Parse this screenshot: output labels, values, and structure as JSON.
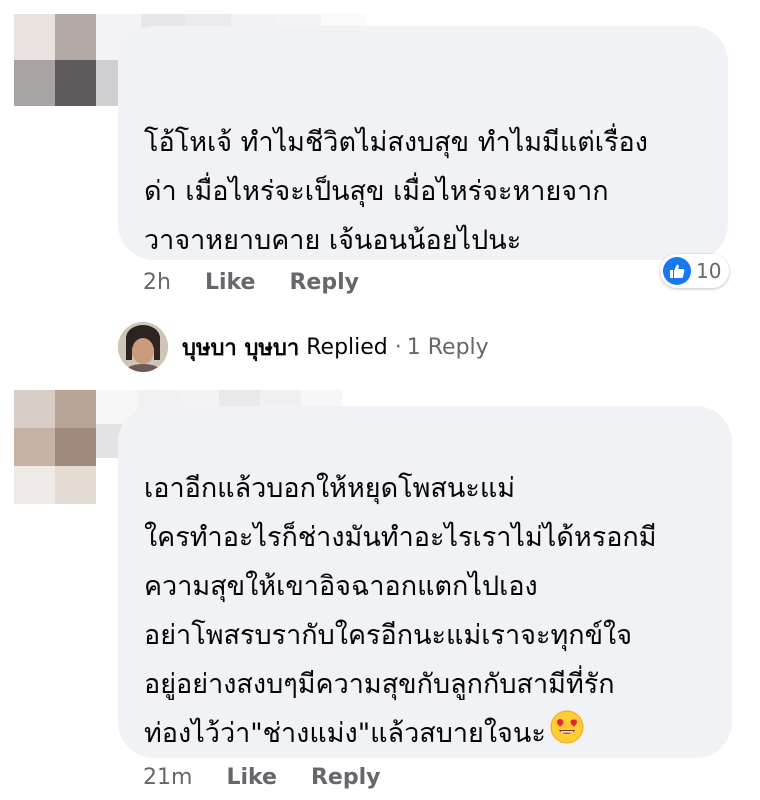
{
  "comment1": {
    "lines": [
      "โอ้โหเจ้ ทำไมชีวิตไม่สงบสุข ทำไมมีแต่เรื่อง",
      "ด่า เมื่อไหร่จะเป็นสุข เมื่อไหร่จะหายจาก",
      "วาจาหยาบคาย เจ้นอนน้อยไปนะ"
    ],
    "time": "2h",
    "like_label": "Like",
    "reply_label": "Reply",
    "reaction_count": "10",
    "reaction_icon": "like-thumb-icon"
  },
  "replies_row": {
    "names": "บุษบา บุษบา",
    "verb": "Replied",
    "separator": "·",
    "count": "1 Reply"
  },
  "comment2": {
    "lines": [
      "เอาอีกแล้วบอกให้หยุดโพสนะแม่",
      "ใครทำอะไรก็ช่างมันทำอะไรเราไม่ได้หรอกมี",
      "ความสุขให้เขาอิจฉาอกแตกไปเอง",
      "อย่าโพสรบรากับใครอีกนะแม่เราจะทุกข์ใจ",
      "อยู่อย่างสงบๆมีความสุขกับลูกกับสามีที่รัก",
      "ท่องไว้ว่า\"ช่างแม่ง\"แล้วสบายใจนะ"
    ],
    "emoji": "heart-eyes-emoji-icon",
    "time": "21m",
    "like_label": "Like",
    "reply_label": "Reply"
  },
  "colors": {
    "bubble": "#f0f2f5",
    "meta_text": "#65676b",
    "like_blue": "#1877f2"
  }
}
